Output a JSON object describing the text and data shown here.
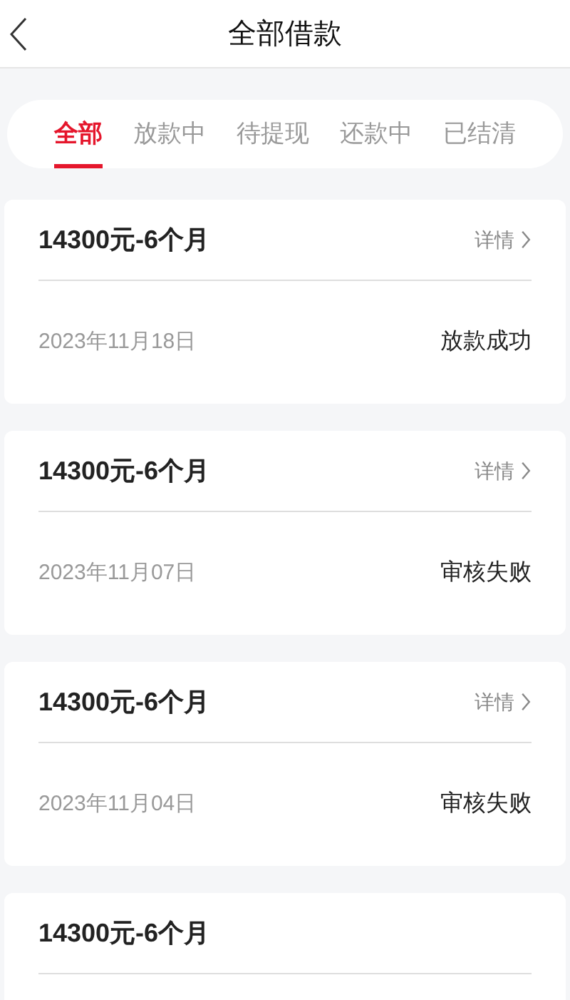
{
  "header": {
    "title": "全部借款"
  },
  "tabs": [
    {
      "label": "全部",
      "selected": true
    },
    {
      "label": "放款中",
      "selected": false
    },
    {
      "label": "待提现",
      "selected": false
    },
    {
      "label": "还款中",
      "selected": false
    },
    {
      "label": "已结清",
      "selected": false
    }
  ],
  "loans": [
    {
      "title": "14300元-6个月",
      "link": "详情",
      "date": "2023年11月18日",
      "status": "放款成功"
    },
    {
      "title": "14300元-6个月",
      "link": "详情",
      "date": "2023年11月07日",
      "status": "审核失败"
    },
    {
      "title": "14300元-6个月",
      "link": "详情",
      "date": "2023年11月04日",
      "status": "审核失败"
    },
    {
      "title": "14300元-6个月"
    }
  ]
}
